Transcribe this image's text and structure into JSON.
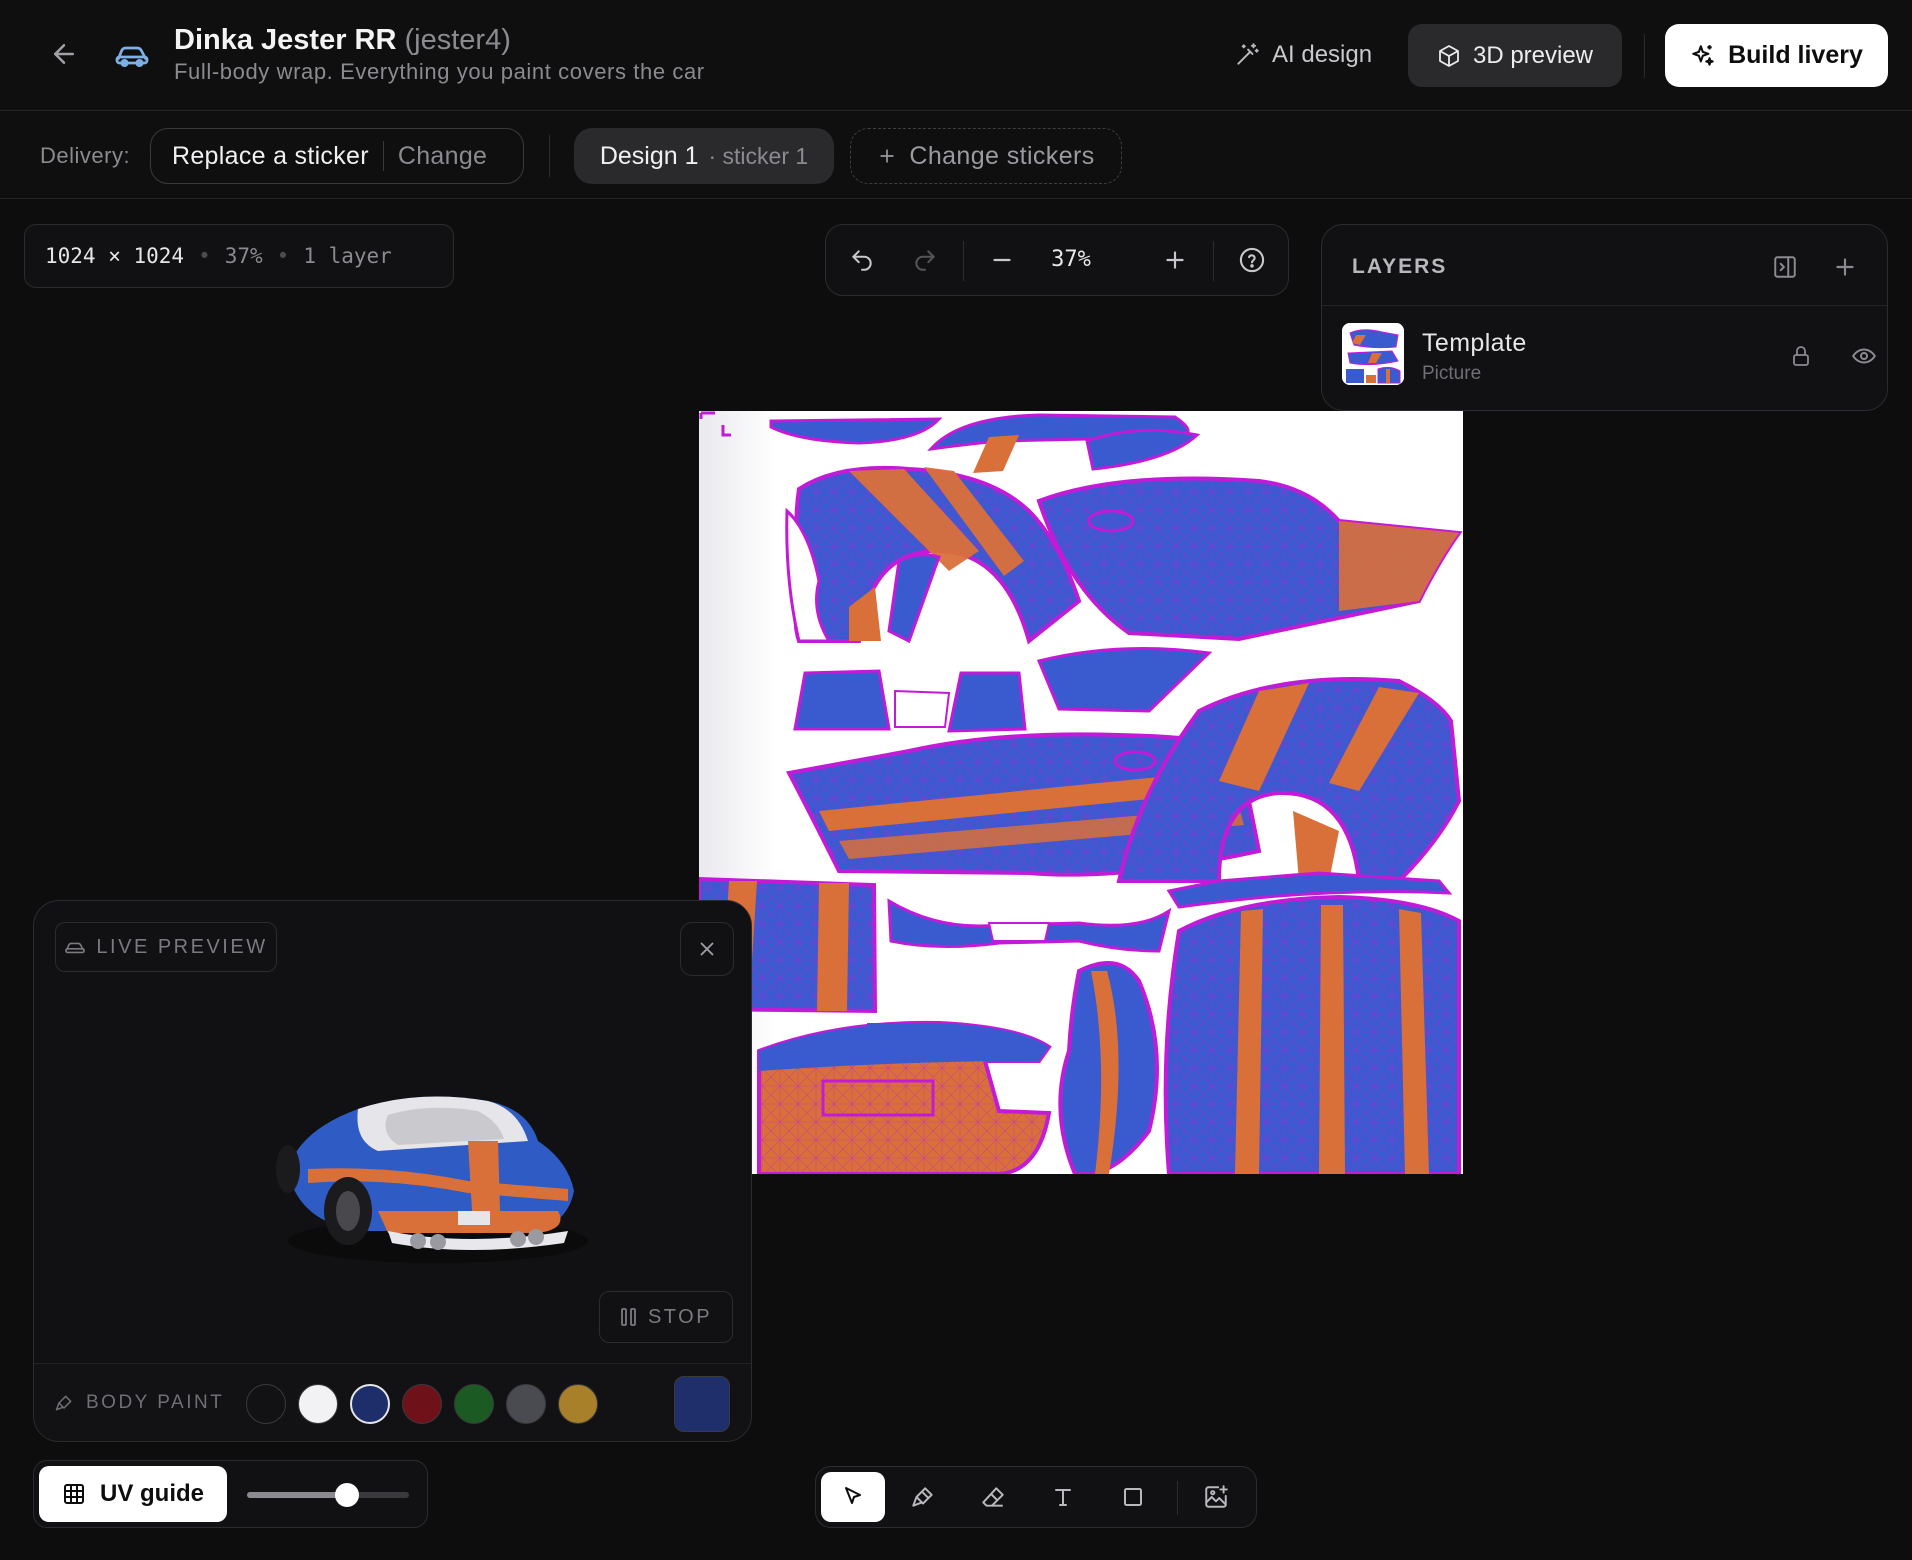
{
  "header": {
    "title": "Dinka Jester RR",
    "model_code": "(jester4)",
    "subtitle": "Full-body wrap. Everything you paint covers the car",
    "ai_design_label": "AI design",
    "preview_3d_label": "3D preview",
    "build_livery_label": "Build livery"
  },
  "delivery": {
    "label": "Delivery:",
    "mode": "Replace a sticker",
    "change_label": "Change",
    "design_label": "Design 1",
    "design_sub": "· sticker 1",
    "change_stickers_label": "Change stickers"
  },
  "canvas_info": {
    "size": "1024 × 1024",
    "zoom": "37%",
    "layers": "1 layer"
  },
  "zoom_toolbar": {
    "level": "37%"
  },
  "layers_panel": {
    "title": "LAYERS",
    "items": [
      {
        "name": "Template",
        "type": "Picture",
        "locked": true,
        "visible": true
      }
    ]
  },
  "live_preview": {
    "badge": "LIVE PREVIEW",
    "stop_label": "STOP",
    "body_paint_label": "BODY PAINT",
    "swatches": [
      "#121214",
      "#f2f2f4",
      "#1d2e6b",
      "#6e1118",
      "#1c5a23",
      "#4a4b50",
      "#a8802a"
    ],
    "selected_swatch": "#1d2e6b",
    "current_color": "#1f2f6b"
  },
  "uv_guide": {
    "label": "UV guide",
    "opacity": 0.64
  },
  "tools": {
    "active": "select"
  },
  "colors": {
    "background": "#0d0d0e",
    "panel": "#111113",
    "uv_blue": "#3a5ad0",
    "uv_orange": "#d9703a",
    "uv_wire": "#c21bd8"
  }
}
